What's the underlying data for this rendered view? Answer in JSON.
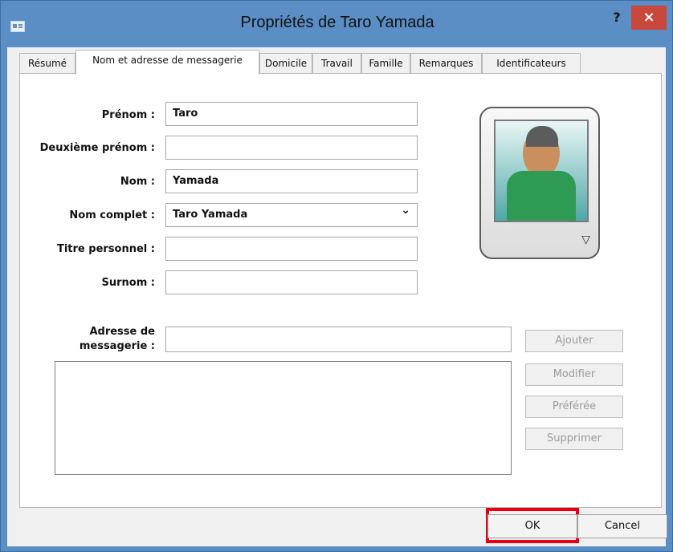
{
  "window": {
    "title": "Propriétés de Taro Yamada",
    "help": "?",
    "close": "×"
  },
  "tabs": [
    {
      "label": "Résumé"
    },
    {
      "label": "Nom et adresse de messagerie"
    },
    {
      "label": "Domicile"
    },
    {
      "label": "Travail"
    },
    {
      "label": "Famille"
    },
    {
      "label": "Remarques"
    },
    {
      "label": "Identificateurs"
    }
  ],
  "form": {
    "prenom_label": "Prénom :",
    "prenom_value": "Taro",
    "deuxieme_prenom_label": "Deuxième prénom :",
    "deuxieme_prenom_value": "",
    "nom_label": "Nom :",
    "nom_value": "Yamada",
    "nom_complet_label": "Nom complet :",
    "nom_complet_value": "Taro Yamada",
    "titre_label": "Titre personnel :",
    "titre_value": "",
    "surnom_label": "Surnom :",
    "surnom_value": "",
    "adresse_label_line1": "Adresse de",
    "adresse_label_line2": "messagerie :",
    "adresse_value": ""
  },
  "buttons": {
    "ajouter": "Ajouter",
    "modifier": "Modifier",
    "preferee": "Préférée",
    "supprimer": "Supprimer",
    "ok": "OK",
    "cancel": "Cancel"
  },
  "colors": {
    "window_frame": "#5a8ec4",
    "close_button": "#c8483b",
    "highlight": "#e60012"
  }
}
